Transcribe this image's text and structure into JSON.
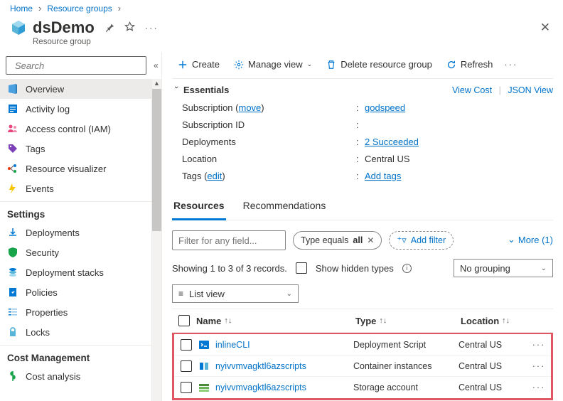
{
  "breadcrumb": {
    "home": "Home",
    "rg": "Resource groups"
  },
  "header": {
    "title": "dsDemo",
    "subtitle": "Resource group"
  },
  "search": {
    "placeholder": "Search"
  },
  "sidebar": {
    "items": [
      {
        "label": "Overview"
      },
      {
        "label": "Activity log"
      },
      {
        "label": "Access control (IAM)"
      },
      {
        "label": "Tags"
      },
      {
        "label": "Resource visualizer"
      },
      {
        "label": "Events"
      }
    ],
    "settings_heading": "Settings",
    "settings": [
      {
        "label": "Deployments"
      },
      {
        "label": "Security"
      },
      {
        "label": "Deployment stacks"
      },
      {
        "label": "Policies"
      },
      {
        "label": "Properties"
      },
      {
        "label": "Locks"
      }
    ],
    "cost_heading": "Cost Management",
    "cost": [
      {
        "label": "Cost analysis"
      }
    ]
  },
  "toolbar": {
    "create": "Create",
    "manage": "Manage view",
    "delete": "Delete resource group",
    "refresh": "Refresh"
  },
  "essentials": {
    "title": "Essentials",
    "view_cost": "View Cost",
    "json_view": "JSON View",
    "rows": {
      "subscription_k": "Subscription",
      "subscription_move": "move",
      "subscription_v": "godspeed",
      "subid_k": "Subscription ID",
      "subid_v": "",
      "deploy_k": "Deployments",
      "deploy_v": "2 Succeeded",
      "loc_k": "Location",
      "loc_v": "Central US",
      "tags_k": "Tags",
      "tags_edit": "edit",
      "tags_v": "Add tags"
    }
  },
  "tabs": {
    "resources": "Resources",
    "recommendations": "Recommendations"
  },
  "filter": {
    "placeholder": "Filter for any field...",
    "type_prefix": "Type equals ",
    "type_val": "all",
    "add": "Add filter",
    "more": "More (1)"
  },
  "controls": {
    "showing": "Showing 1 to 3 of 3 records.",
    "hidden": "Show hidden types",
    "grouping": "No grouping",
    "listview": "List view"
  },
  "table": {
    "headers": {
      "name": "Name",
      "type": "Type",
      "location": "Location"
    },
    "rows": [
      {
        "name": "inlineCLI",
        "type": "Deployment Script",
        "location": "Central US",
        "icon": "ds"
      },
      {
        "name": "nyivvmvagktl6azscripts",
        "type": "Container instances",
        "location": "Central US",
        "icon": "ci"
      },
      {
        "name": "nyivvmvagktl6azscripts",
        "type": "Storage account",
        "location": "Central US",
        "icon": "sa"
      }
    ]
  }
}
